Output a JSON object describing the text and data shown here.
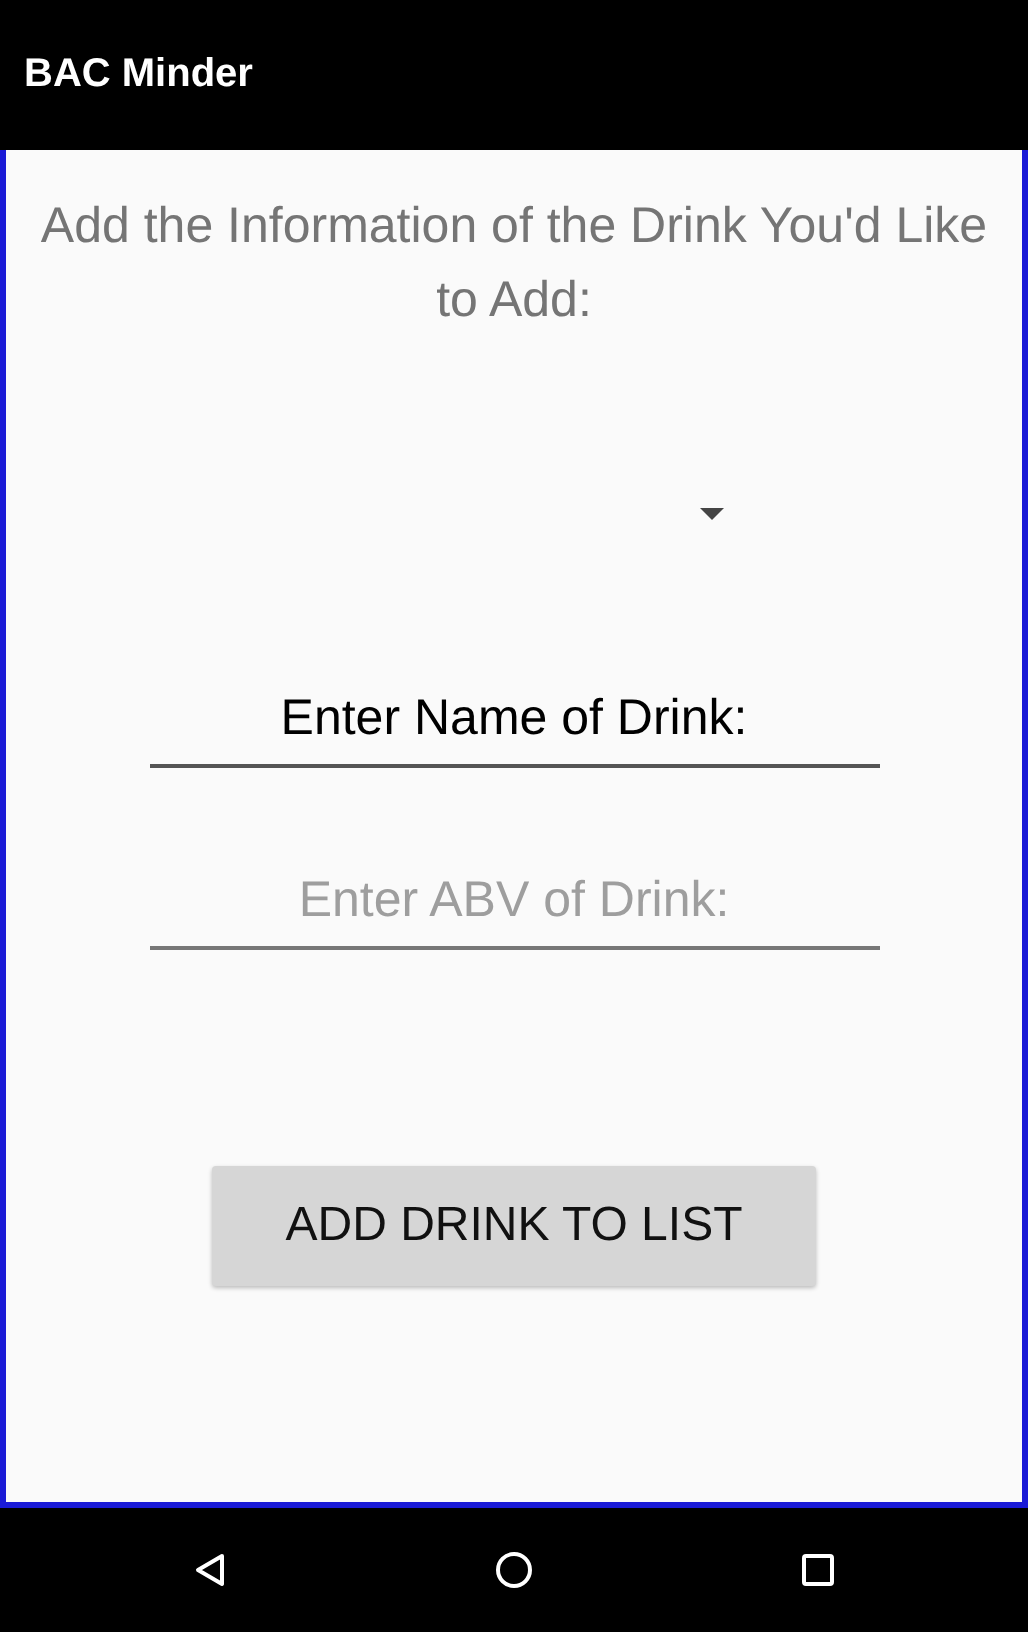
{
  "app_bar": {
    "title": "BAC Minder"
  },
  "heading": "Add the Information of the Drink You'd Like to Add:",
  "name_field": {
    "value": "Enter Name of Drink:"
  },
  "abv_field": {
    "placeholder": "Enter ABV of Drink:"
  },
  "button": "ADD DRINK TO LIST"
}
